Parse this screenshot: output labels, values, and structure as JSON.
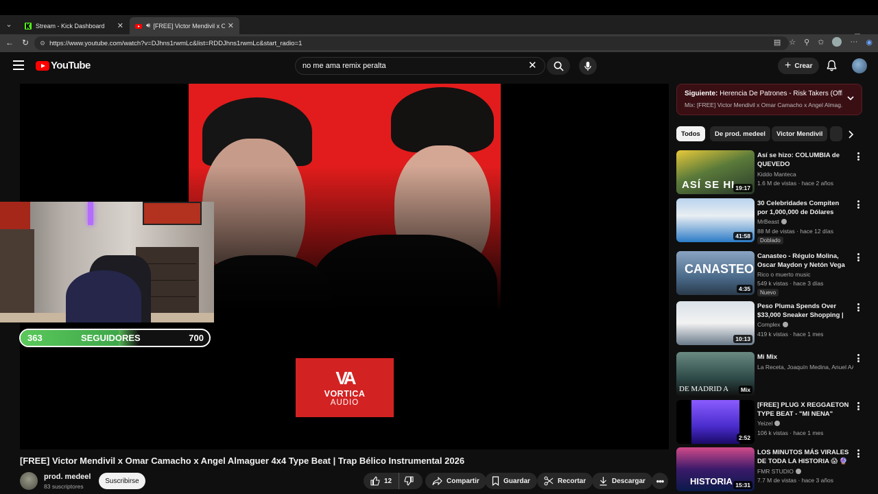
{
  "browser": {
    "tabs": [
      {
        "title": "Stream - Kick Dashboard"
      },
      {
        "title": "[FREE] Victor Mendivil x Omar"
      }
    ],
    "url": "https://www.youtube.com/watch?v=DJhns1rwmLc&list=RDDJhns1rwmLc&start_radio=1"
  },
  "header": {
    "logo_text": "YouTube",
    "search_value": "no me ama remix peralta",
    "create_label": "Crear"
  },
  "overlay": {
    "followers_current": "363",
    "followers_label": "SEGUIDORES",
    "followers_goal": "700",
    "followers_progress": 0.52
  },
  "video": {
    "watermark_line1": "VORTICA",
    "watermark_line2": "AUDIO",
    "title": "[FREE] Victor Mendivil x Omar Camacho x Angel Almaguer 4x4 Type Beat | Trap Bélico Instrumental 2026",
    "channel": "prod. medeel",
    "subscribers": "83 suscriptores",
    "subscribe_label": "Suscribirse",
    "likes": "12",
    "share_label": "Compartir",
    "save_label": "Guardar",
    "clip_label": "Recortar",
    "download_label": "Descargar"
  },
  "up_next": {
    "prefix": "Siguiente:",
    "title": "Herencia De Patrones - Risk Takers (Offic...",
    "mix": "Mix: [FREE] Victor Mendivil x Omar Camacho x Angel Almag..."
  },
  "chips": [
    "Todos",
    "De prod. medeel",
    "Victor Mendivil"
  ],
  "recommendations": [
    {
      "title": "Así se hizo: COLUMBIA de QUEVEDO",
      "channel": "Kiddo Manteca",
      "meta": "1.6 M de vistas · hace 2 años",
      "duration": "19:17",
      "badge": ""
    },
    {
      "title": "30 Celebridades Compiten por 1,000,000 de Dólares",
      "channel": "MrBeast",
      "meta": "88 M de vistas · hace 12 días",
      "duration": "41:58",
      "badge": "Doblado"
    },
    {
      "title": "Canasteo - Régulo Molina, Oscar Maydon y Netón Vega ...",
      "channel": "Rico o muerto music",
      "meta": "549 k vistas · hace 3 días",
      "duration": "4:35",
      "badge": "Nuevo"
    },
    {
      "title": "Peso Pluma Spends Over $33,000 Sneaker Shopping | ...",
      "channel": "Complex",
      "meta": "419 k vistas · hace 1 mes",
      "duration": "10:13",
      "badge": ""
    },
    {
      "title": "Mi Mix",
      "channel": "La Receta, Joaquín Medina, Anuel AA y ...",
      "meta": "",
      "duration": "Mix",
      "badge": ""
    },
    {
      "title": "[FREE] PLUG X REGGAETON TYPE BEAT - \"MI NENA\"",
      "channel": "Yeizel",
      "meta": "106 k vistas · hace 1 mes",
      "duration": "2:52",
      "badge": ""
    },
    {
      "title": "LOS MINUTOS MÁS VIRALES DE TODA LA HISTORIA 😱 🔮 |...",
      "channel": "FMR STUDIO",
      "meta": "7.7 M de vistas · hace 3 años",
      "duration": "15:31",
      "badge": ""
    }
  ],
  "colors": {
    "yt_red": "#ff0000",
    "up_next_bg": "#3a0f14",
    "progress_green": "#5ac85a"
  }
}
